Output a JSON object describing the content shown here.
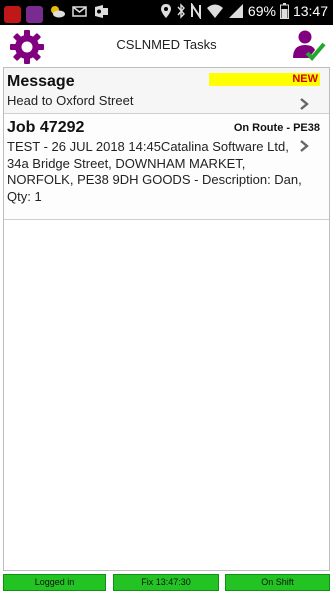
{
  "status_bar": {
    "battery": "69%",
    "time": "13:47",
    "icons": [
      "app-notification-icon",
      "app-notification-icon",
      "weather-icon",
      "email-icon",
      "outlook-icon",
      "location-icon",
      "bluetooth-icon",
      "nfc-icon",
      "wifi-icon",
      "signal-icon",
      "battery-icon"
    ]
  },
  "header": {
    "title": "CSLNMED Tasks",
    "settings_icon": "gear-icon",
    "user_icon": "user-check-icon",
    "accent_color": "#800080"
  },
  "tasks": [
    {
      "title": "Message",
      "line": "Head to Oxford Street",
      "badge": "NEW"
    },
    {
      "title": "Job 47292",
      "status": "On Route - PE38",
      "body": "TEST - 26 JUL 2018 14:45Catalina Software Ltd, 34a Bridge Street, DOWNHAM MARKET, NORFOLK, PE38 9DH GOODS - Description: Dan, Qty: 1"
    }
  ],
  "bottom_bar": {
    "logged_in": "Logged in",
    "fix": "Fix 13:47:30",
    "shift": "On Shift",
    "color": "#22c322"
  }
}
